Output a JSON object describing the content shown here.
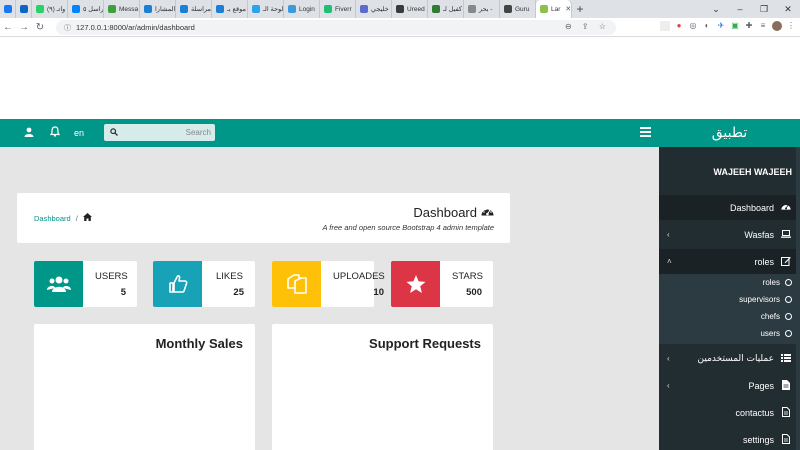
{
  "browser": {
    "tabs": [
      {
        "label": "",
        "color": "#1877f2"
      },
      {
        "label": "",
        "color": "#0a66c2"
      },
      {
        "label": "(٩) واتـ",
        "color": "#25d366"
      },
      {
        "label": "راسل ٥",
        "color": "#0084ff"
      },
      {
        "label": "Messa",
        "color": "#3ca03c"
      },
      {
        "label": "المشارا",
        "color": "#1c7ed6"
      },
      {
        "label": "مراسلة",
        "color": "#1c7ed6"
      },
      {
        "label": "موقع بـ",
        "color": "#1c7ed6"
      },
      {
        "label": "لوحة الـ",
        "color": "#2aa3ef"
      },
      {
        "label": "Login",
        "color": "#3c9adb"
      },
      {
        "label": "Fiverr",
        "color": "#1dbf73"
      },
      {
        "label": "خليجي",
        "color": "#5b6acd"
      },
      {
        "label": "Ureed",
        "color": "#3a3a3a"
      },
      {
        "label": "كفيل لـ",
        "color": "#2e7d32"
      },
      {
        "label": "بحر -",
        "color": "#888888"
      },
      {
        "label": "Guru",
        "color": "#444444"
      },
      {
        "label": "Lar",
        "color": "#8bc34a"
      }
    ],
    "url": "127.0.0.1:8000/ar/admin/dashboard"
  },
  "header": {
    "lang": "en",
    "search_placeholder": "Search",
    "brand": "تطبيق"
  },
  "main": {
    "title": "Dashboard",
    "subtitle": "A free and open source Bootstrap 4 admin template",
    "breadcrumb": {
      "link": "Dashboard",
      "separator": "/"
    }
  },
  "widgets": [
    {
      "label": "USERS",
      "value": "5",
      "color": "#009688",
      "icon": "users-icon"
    },
    {
      "label": "LIKES",
      "value": "25",
      "color": "#17a2b8",
      "icon": "thumbs-up-icon"
    },
    {
      "label": "UPLOADES",
      "value": "10",
      "color": "#ffc107",
      "icon": "files-icon"
    },
    {
      "label": "STARS",
      "value": "500",
      "color": "#dc3545",
      "icon": "star-icon"
    }
  ],
  "panels": {
    "monthly_sales": "Monthly Sales",
    "support_requests": "Support Requests"
  },
  "sidebar": {
    "user": "WAJEEH WAJEEH",
    "items": [
      {
        "label": "Dashboard",
        "icon": "dashboard-icon"
      },
      {
        "label": "Wasfas",
        "icon": "laptop-icon"
      },
      {
        "label": "roles",
        "icon": "edit-icon"
      },
      {
        "label": "عمليات المستخدمين",
        "icon": "list-icon"
      },
      {
        "label": "Pages",
        "icon": "file-icon"
      },
      {
        "label": "contactus",
        "icon": "file-text-icon"
      },
      {
        "label": "settings",
        "icon": "file-text-icon"
      }
    ],
    "submenu": [
      "roles",
      "supervisors",
      "chefs",
      "users"
    ]
  }
}
